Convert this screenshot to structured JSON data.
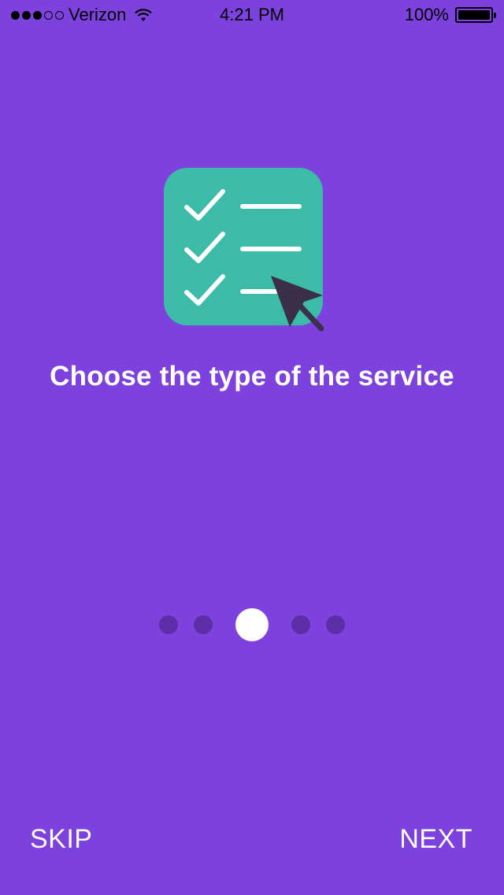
{
  "status_bar": {
    "carrier": "Verizon",
    "time": "4:21 PM",
    "battery": "100%",
    "signal_bars_filled": 3,
    "signal_bars_total": 5
  },
  "onboarding": {
    "headline": "Choose the type of the service",
    "icon": "checklist-with-cursor-icon",
    "pages_total": 5,
    "current_page": 3
  },
  "actions": {
    "skip_label": "SKIP",
    "next_label": "NEXT"
  },
  "colors": {
    "background": "#7d42de",
    "icon_tile": "#3bbba8",
    "cursor": "#3b2f4a",
    "inactive_dot": "#5d2ea8",
    "active_dot": "#ffffff"
  }
}
